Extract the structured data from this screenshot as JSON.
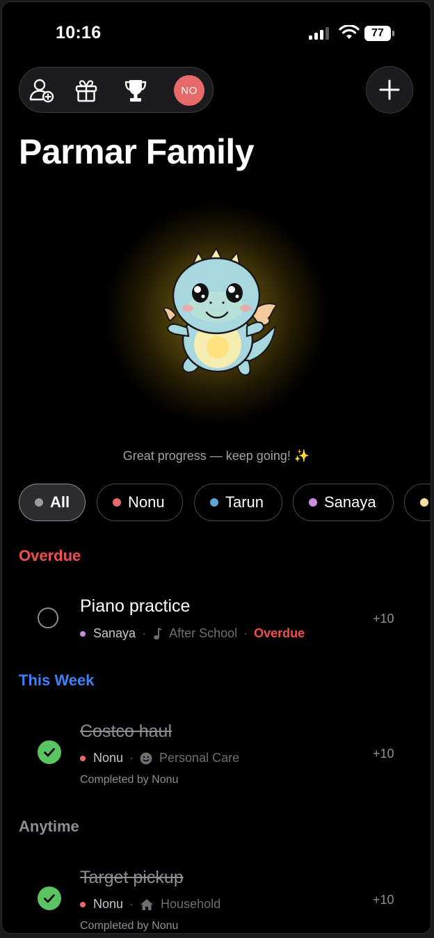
{
  "status_bar": {
    "time": "10:16",
    "battery": "77"
  },
  "toolbar": {
    "avatar_initials": "NO"
  },
  "page_title": "Parmar Family",
  "progress_message": "Great progress — keep going! ✨",
  "filters": [
    {
      "label": "All",
      "color": "#9a9a9e",
      "active": true
    },
    {
      "label": "Nonu",
      "color": "#e76a6a"
    },
    {
      "label": "Tarun",
      "color": "#5aa6d0"
    },
    {
      "label": "Sanaya",
      "color": "#c98ee0"
    },
    {
      "label": "",
      "color": "#f3dca0"
    }
  ],
  "sections": {
    "overdue": {
      "title": "Overdue",
      "color": "#ef4f4f",
      "task": {
        "title": "Piano practice",
        "person": "Sanaya",
        "person_color": "#c98ee0",
        "category": "After School",
        "category_icon": "music-note-icon",
        "status": "Overdue",
        "points": "+10"
      }
    },
    "this_week": {
      "title": "This Week",
      "color": "#3b82f6",
      "task": {
        "title": "Costco haul",
        "person": "Nonu",
        "person_color": "#e76a6a",
        "category": "Personal Care",
        "category_icon": "smiley-icon",
        "completed_by": "Completed by Nonu",
        "points": "+10",
        "done": true
      }
    },
    "anytime": {
      "title": "Anytime",
      "color": "#8e8e93",
      "task": {
        "title": "Target pickup",
        "person": "Nonu",
        "person_color": "#e76a6a",
        "category": "Household",
        "category_icon": "house-icon",
        "completed_by": "Completed by Nonu",
        "points": "+10",
        "done": true
      }
    }
  }
}
